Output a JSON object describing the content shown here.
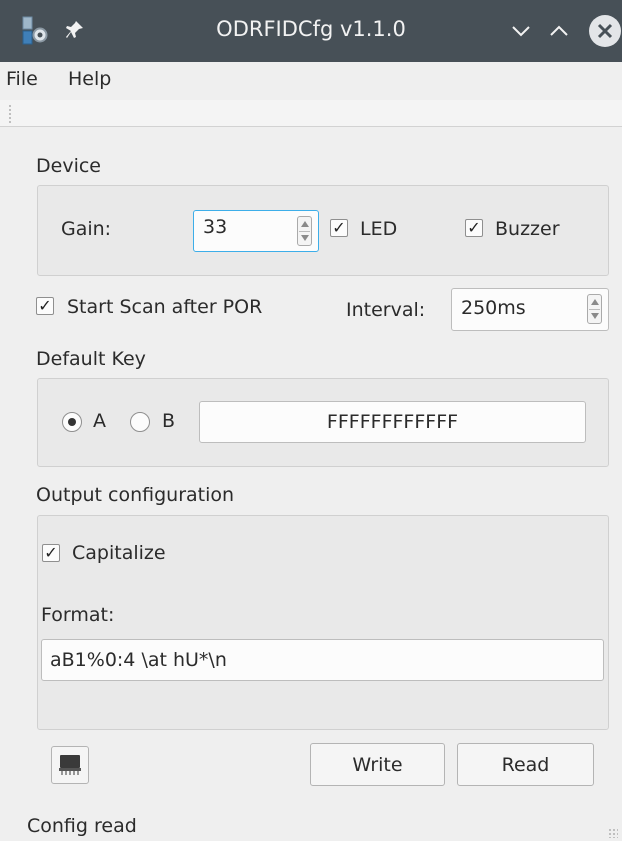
{
  "window": {
    "title": "ODRFIDCfg v1.1.0"
  },
  "menu": {
    "file": "File",
    "help": "Help"
  },
  "device": {
    "title": "Device",
    "gain_label": "Gain:",
    "gain_value": "33",
    "led_label": "LED",
    "led_checked": true,
    "buzzer_label": "Buzzer",
    "buzzer_checked": true
  },
  "scan": {
    "start_scan_label": "Start Scan after POR",
    "start_scan_checked": true,
    "interval_label": "Interval:",
    "interval_value": "250ms"
  },
  "default_key": {
    "title": "Default Key",
    "option_a": "A",
    "option_b": "B",
    "selected": "A",
    "key_value": "FFFFFFFFFFFF"
  },
  "output": {
    "title": "Output configuration",
    "capitalize_label": "Capitalize",
    "capitalize_checked": true,
    "format_label": "Format:",
    "format_value": "aB1%0:4 \\at hU*\\n"
  },
  "actions": {
    "write": "Write",
    "read": "Read",
    "chip_icon": "chip-icon"
  },
  "status": {
    "text": "Config read"
  },
  "colors": {
    "titlebar": "#475057",
    "focus": "#3daee9",
    "background": "#efefef"
  }
}
